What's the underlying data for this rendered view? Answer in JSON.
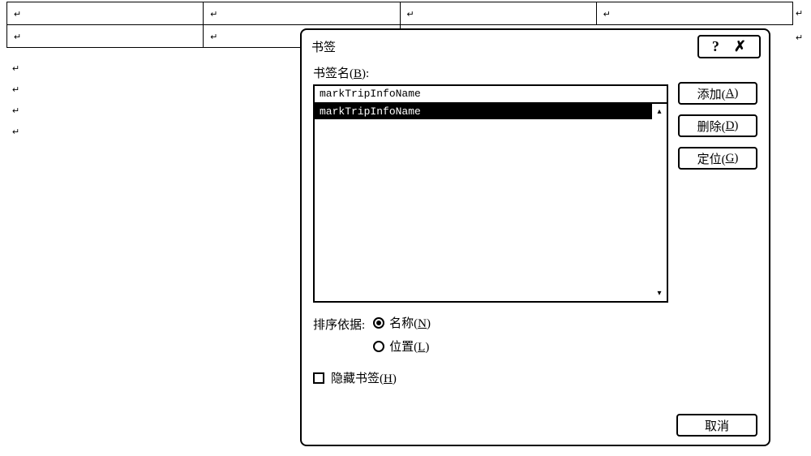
{
  "glyphs": {
    "para": "↵",
    "help": "?",
    "close": "✗",
    "scroll_up": "▴",
    "scroll_down": "▾"
  },
  "dialog": {
    "title": "书签",
    "name_label_prefix": "书签名(",
    "name_label_hotkey": "B",
    "name_label_suffix": "):",
    "name_value": "markTripInfoName",
    "list": {
      "items": [
        "markTripInfoName"
      ],
      "selected_index": 0
    },
    "buttons": {
      "add_prefix": "添加(",
      "add_hotkey": "A",
      "add_suffix": ")",
      "delete_prefix": "删除(",
      "delete_hotkey": "D",
      "delete_suffix": ")",
      "goto_prefix": "定位(",
      "goto_hotkey": "G",
      "goto_suffix": ")",
      "cancel": "取消"
    },
    "sort": {
      "label": "排序依据:",
      "opt_name_prefix": "名称(",
      "opt_name_hotkey": "N",
      "opt_name_suffix": ")",
      "opt_loc_prefix": "位置(",
      "opt_loc_hotkey": "L",
      "opt_loc_suffix": ")",
      "selected": "name"
    },
    "hidden": {
      "label_prefix": "隐藏书签(",
      "label_hotkey": "H",
      "label_suffix": ")",
      "checked": false
    }
  }
}
